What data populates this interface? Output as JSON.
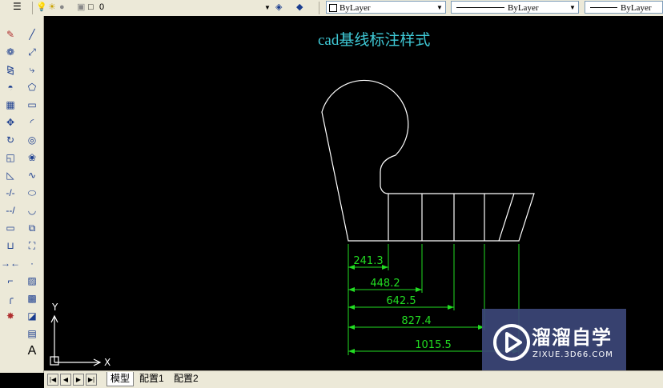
{
  "toolbar": {
    "layer_value": "0",
    "color_value": "ByLayer",
    "linetype_value": "ByLayer",
    "lineweight_value": "ByLayer"
  },
  "canvas": {
    "title": "cad基线标注样式",
    "ucs_y": "Y",
    "ucs_x": "X",
    "dimensions": [
      "241.3",
      "448.2",
      "642.5",
      "827.4",
      "1015.5"
    ]
  },
  "tabs": [
    "模型",
    "配置1",
    "配置2"
  ],
  "watermark": {
    "brand": "溜溜自学",
    "url": "ZIXUE.3D66.COM"
  },
  "colors": {
    "dimension": "#22dd22",
    "title": "#3fc9d6",
    "drawing": "#ffffff"
  }
}
